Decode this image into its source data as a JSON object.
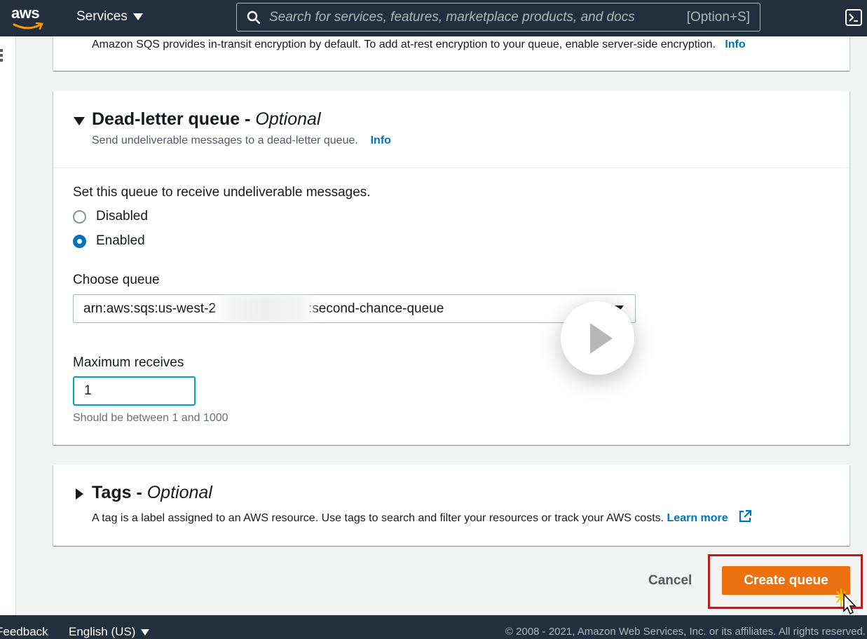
{
  "nav": {
    "logo": "aws",
    "services_label": "Services",
    "search_placeholder": "Search for services, features, marketplace products, and docs",
    "search_shortcut": "[Option+S]"
  },
  "encryption": {
    "description": "Amazon SQS provides in-transit encryption by default. To add at-rest encryption to your queue, enable server-side encryption.",
    "info_label": "Info"
  },
  "dead_letter": {
    "title": "Dead-letter queue",
    "title_separator": " - ",
    "optional": "Optional",
    "description": "Send undeliverable messages to a dead-letter queue.",
    "info_label": "Info",
    "set_queue_label": "Set this queue to receive undeliverable messages.",
    "option_disabled": "Disabled",
    "option_enabled": "Enabled",
    "selected_option": "Enabled",
    "choose_queue_label": "Choose queue",
    "queue_prefix": "arn:aws:sqs:us-west-2",
    "queue_suffix": ":second-chance-queue",
    "max_receives_label": "Maximum receives",
    "max_receives_value": "1",
    "max_receives_hint": "Should be between 1 and 1000"
  },
  "tags": {
    "title": "Tags",
    "title_separator": " - ",
    "optional": "Optional",
    "description": "A tag is a label assigned to an AWS resource. Use tags to search and filter your resources or track your AWS costs.",
    "learn_more": "Learn more"
  },
  "actions": {
    "cancel_label": "Cancel",
    "create_label": "Create queue"
  },
  "footer": {
    "feedback": "Feedback",
    "language": "English (US)",
    "copyright": "© 2008 - 2021, Amazon Web Services, Inc. or its affiliates. All rights reserved."
  },
  "colors": {
    "nav_bg": "#232f3e",
    "link": "#0073bb",
    "primary_button": "#ec7211",
    "highlight_box": "#b31e1e",
    "focus_border": "#00a1c9"
  }
}
